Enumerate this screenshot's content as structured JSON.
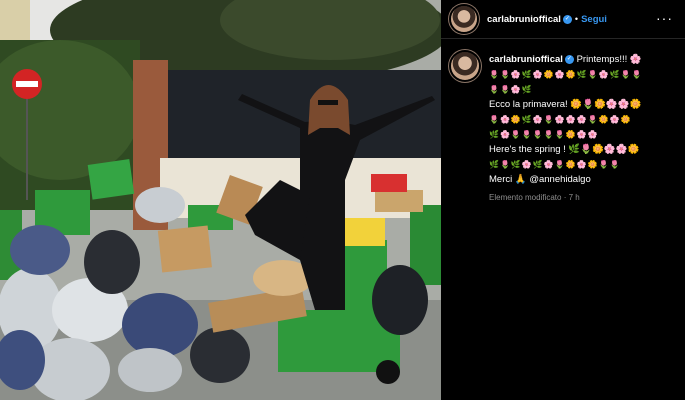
{
  "post_header": {
    "username": "carlabrunioffical",
    "verified_label": "✓",
    "separator": "•",
    "follow_label": "Segui",
    "more_label": "···"
  },
  "caption": {
    "username": "carlabrunioffical",
    "lines": [
      "Printemps!!! 🌸",
      "🌷🌷🌸🌿🌸🌼🌸🌼🌿🌷🌸🌿🌷🌷",
      "🌷🌷🌸🌿",
      "Ecco la primavera! 🌼🌷🌼🌸🌸🌼",
      "🌷🌸🌼🌿🌸🌷🌸🌸🌸🌷🌼🌸🌼",
      "🌿🌸🌷🌷🌷🌷🌷🌼🌸🌸",
      "Here's the spring ! 🌿🌷🌼🌸🌸🌼",
      "🌿🌷🌿🌸🌿🌸🌷🌼🌸🌼🌷🌷",
      "Merci 🙏 @annehidalgo"
    ],
    "edited_note": "Elemento modificato",
    "time_sep": "·",
    "time": "7 h"
  },
  "photo": {
    "description_colors": {
      "wall": "#eae4d6",
      "fence": "#1f2329",
      "bin_green": "#2f9a3c",
      "pavement": "#8c8f8a"
    }
  }
}
